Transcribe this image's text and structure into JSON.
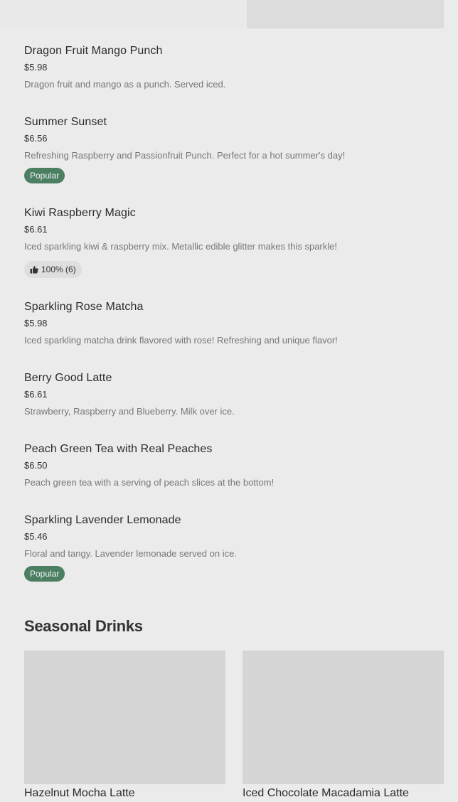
{
  "menu_items": [
    {
      "name": "Dragon Fruit Mango Punch",
      "price": "$5.98",
      "description": "Dragon fruit and mango as a punch. Served iced."
    },
    {
      "name": "Summer Sunset",
      "price": "$6.56",
      "description": "Refreshing Raspberry and Passionfruit Punch. Perfect for a hot summer's day!",
      "badge": "Popular"
    },
    {
      "name": "Kiwi Raspberry Magic",
      "price": "$6.61",
      "description": "Iced sparkling kiwi & raspberry mix. Metallic edible glitter makes this sparkle!",
      "rating": "100% (6)"
    },
    {
      "name": "Sparkling Rose Matcha",
      "price": "$5.98",
      "description": "Iced sparkling matcha drink flavored with rose! Refreshing and unique flavor!"
    },
    {
      "name": "Berry Good Latte",
      "price": "$6.61",
      "description": "Strawberry, Raspberry and Blueberry. Milk over ice."
    },
    {
      "name": "Peach Green Tea with Real Peaches",
      "price": "$6.50",
      "description": "Peach green tea with a serving of peach slices at the bottom!"
    },
    {
      "name": "Sparkling Lavender Lemonade",
      "price": "$5.46",
      "description": "Floral and tangy. Lavender lemonade served on ice.",
      "badge": "Popular"
    }
  ],
  "seasonal": {
    "title": "Seasonal Drinks",
    "cards": [
      {
        "name": "Hazelnut Mocha Latte"
      },
      {
        "name": "Iced Chocolate Macadamia Latte"
      }
    ]
  },
  "icons": {
    "rating": "thumbs-up-icon"
  },
  "colors": {
    "popular_badge": "#4b7f62",
    "background": "#ebebeb"
  }
}
